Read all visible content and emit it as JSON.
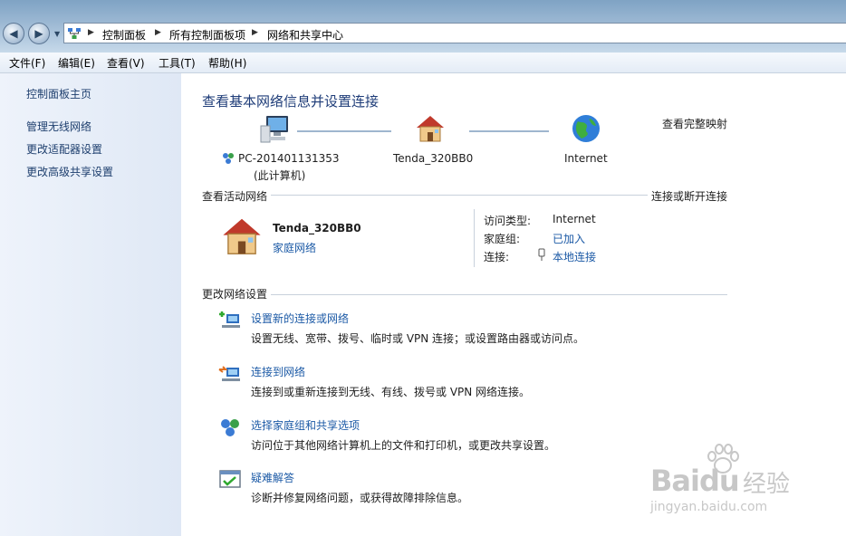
{
  "address": {
    "crumbs": [
      "控制面板",
      "所有控制面板项",
      "网络和共享中心"
    ]
  },
  "menu": [
    "文件(F)",
    "编辑(E)",
    "查看(V)",
    "工具(T)",
    "帮助(H)"
  ],
  "sidebar": {
    "home": "控制面板主页",
    "items": [
      "管理无线网络",
      "更改适配器设置",
      "更改高级共享设置"
    ]
  },
  "main": {
    "title": "查看基本网络信息并设置连接",
    "view_full_map": "查看完整映射",
    "map": {
      "computer_name": "PC-201401131353",
      "computer_sub": "(此计算机)",
      "router_name": "Tenda_320BB0",
      "internet_name": "Internet"
    },
    "active": {
      "section_title": "查看活动网络",
      "connect_disconnect": "连接或断开连接",
      "network_name": "Tenda_320BB0",
      "network_type": "家庭网络",
      "access_type_label": "访问类型:",
      "access_type_value": "Internet",
      "homegroup_label": "家庭组:",
      "homegroup_value": "已加入",
      "connection_label": "连接:",
      "connection_value": "本地连接"
    },
    "change": {
      "section_title": "更改网络设置",
      "tasks": [
        {
          "link": "设置新的连接或网络",
          "desc": "设置无线、宽带、拨号、临时或 VPN 连接；或设置路由器或访问点。"
        },
        {
          "link": "连接到网络",
          "desc": "连接到或重新连接到无线、有线、拨号或 VPN 网络连接。"
        },
        {
          "link": "选择家庭组和共享选项",
          "desc": "访问位于其他网络计算机上的文件和打印机，或更改共享设置。"
        },
        {
          "link": "疑难解答",
          "desc": "诊断并修复网络问题，或获得故障排除信息。"
        }
      ]
    }
  },
  "watermark": {
    "brand": "Baidu",
    "brand_cn": "经验",
    "url": "jingyan.baidu.com"
  }
}
